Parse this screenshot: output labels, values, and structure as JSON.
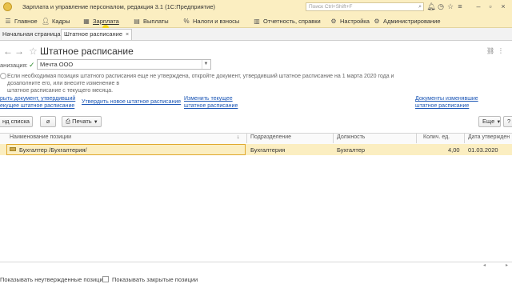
{
  "window": {
    "title": "Зарплата и управление персоналом, редакция 3.1  (1С:Предприятие)",
    "search_placeholder": "Поиск Ctrl+Shift+F",
    "icons": [
      "bell-icon",
      "history-icon",
      "star-icon",
      "menu-icon",
      "minimize-icon",
      "restore-icon",
      "close-icon"
    ]
  },
  "menu": [
    {
      "label": "Главное",
      "icon": "menu-icon"
    },
    {
      "label": "Кадры",
      "icon": "person-icon"
    },
    {
      "label": "Зарплата",
      "icon": "calculator-icon"
    },
    {
      "label": "Выплаты",
      "icon": "wallet-icon"
    },
    {
      "label": "Налоги и взносы",
      "icon": "percent-icon"
    },
    {
      "label": "Отчетность, справки",
      "icon": "chart-icon"
    },
    {
      "label": "Настройка",
      "icon": "gear-icon"
    },
    {
      "label": "Администрирование",
      "icon": "admin-icon"
    }
  ],
  "tabs": [
    {
      "label": "Начальная страница"
    },
    {
      "label": "Штатное расписание",
      "close": "×"
    }
  ],
  "form": {
    "title": "Штатное расписание",
    "org_label": "анизация:",
    "org_value": "Мечта ООО",
    "info_line1": "Если необходимая позиция штатного расписания еще не утверждена, откройте документ, утвердивший штатное расписание на 1 марта 2020 года и дозаполните его, или внесите изменение в",
    "info_line2": "штатное расписание с текущего месяца.",
    "links": {
      "open_doc_1": "рыть документ, утвердивший",
      "open_doc_2": "екущее штатное расписание",
      "approve_new": "Утвердить новое штатное расписание",
      "change_1": "Изменить текущее",
      "change_2": "штатное расписание",
      "docs_1": "Документы изменявшие",
      "docs_2": "штатное расписание"
    }
  },
  "toolbar": {
    "list_btn": "нд списка",
    "print_btn": "Печать",
    "more_btn": "Еще",
    "help_btn": "?"
  },
  "table": {
    "columns": [
      "Наименование позиции",
      "Подразделение",
      "Должность",
      "Колич. ед.",
      "Дата утвержден"
    ],
    "sort_arrow": "↓",
    "rows": [
      {
        "name": "Бухгалтер /Бухгалтерия/",
        "dept": "Бухгалтерия",
        "position": "Бухгалтер",
        "qty": "4,00",
        "date": "01.03.2020"
      }
    ]
  },
  "footer": {
    "show_unapproved": "Показывать неутвержденные позиции",
    "show_closed": "Показывать закрытые позиции"
  },
  "colors": {
    "accent": "#fbeec1",
    "link": "#1a55b5",
    "selection_border": "#e0a82c"
  }
}
